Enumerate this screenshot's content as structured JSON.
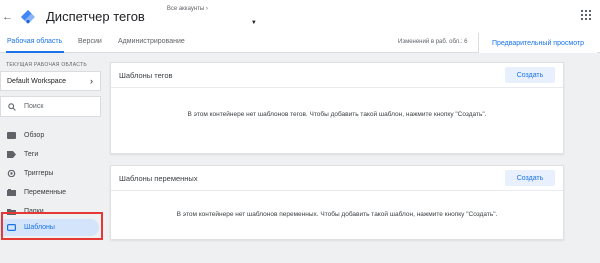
{
  "header": {
    "back_glyph": "←",
    "title": "Диспетчер тегов",
    "account_label": "Все аккаунты",
    "account_chevron": "›",
    "account_caret": "▼"
  },
  "tabs": [
    {
      "label": "Рабочая область",
      "active": true
    },
    {
      "label": "Версии",
      "active": false
    },
    {
      "label": "Администрирование",
      "active": false
    }
  ],
  "status": {
    "changes": "Изменений в раб. обл.: 6",
    "preview_button": "Предварительный просмотр"
  },
  "sidebar": {
    "workspace_label": "ТЕКУЩАЯ РАБОЧАЯ ОБЛАСТЬ",
    "workspace_name": "Default Workspace",
    "workspace_chevron": "›",
    "search_placeholder": "Поиск",
    "items": [
      {
        "label": "Обзор",
        "icon": "overview-icon",
        "active": false
      },
      {
        "label": "Теги",
        "icon": "tag-icon",
        "active": false
      },
      {
        "label": "Триггеры",
        "icon": "trigger-icon",
        "active": false
      },
      {
        "label": "Переменные",
        "icon": "variable-icon",
        "active": false
      },
      {
        "label": "Папки",
        "icon": "folder-icon",
        "active": false
      },
      {
        "label": "Шаблоны",
        "icon": "template-icon",
        "active": true
      }
    ]
  },
  "cards": {
    "tag_templates": {
      "title": "Шаблоны тегов",
      "button": "Создать",
      "empty": "В этом контейнере нет шаблонов тегов. Чтобы добавить такой шаблон, нажмите кнопку \"Создать\"."
    },
    "variable_templates": {
      "title": "Шаблоны переменных",
      "button": "Создать",
      "empty": "В этом контейнере нет шаблонов переменных. Чтобы добавить такой шаблон, нажмите кнопку \"Создать\"."
    }
  },
  "colors": {
    "accent": "#1a73e8",
    "active_nav_bg": "#d4e5fb",
    "highlight_border": "#e53935",
    "page_bg": "#eef0f2"
  }
}
